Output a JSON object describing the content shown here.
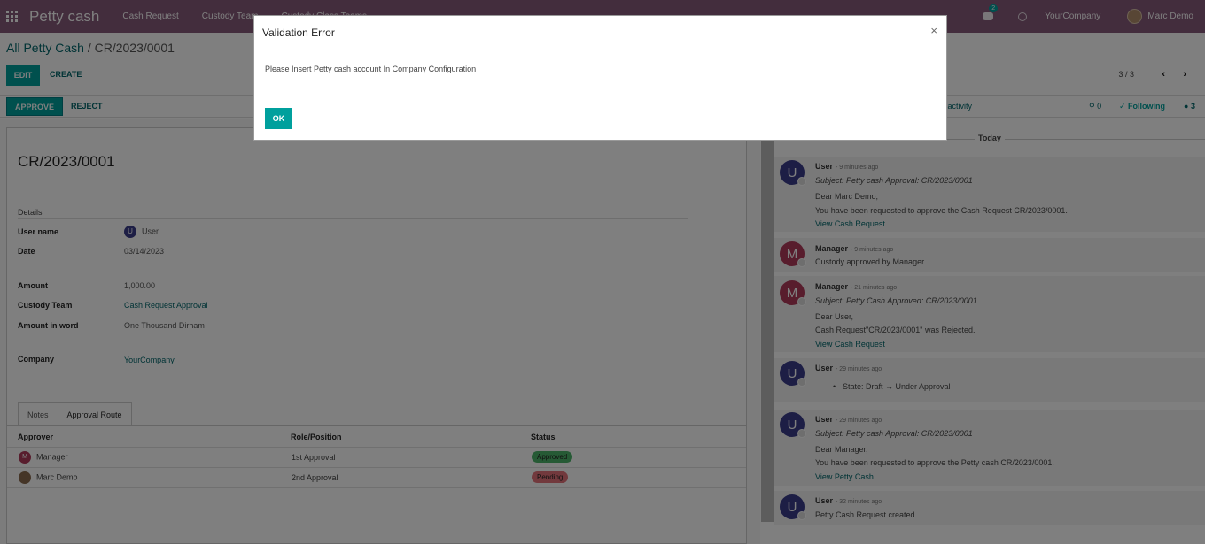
{
  "nav": {
    "brand": "Petty cash",
    "items": [
      "Cash Request",
      "Custody Team",
      "Custody Class Teams"
    ],
    "chat_count": "2",
    "company": "YourCompany",
    "user": "Marc Demo"
  },
  "control": {
    "breadcrumb_root": "All Petty Cash",
    "breadcrumb_sep": " / ",
    "breadcrumb_current": "CR/2023/0001",
    "edit_label": "EDIT",
    "create_label": "CREATE",
    "pager": "3 / 3"
  },
  "status": {
    "approve_label": "APPROVE",
    "reject_label": "REJECT",
    "schedule_label": "ule activity",
    "attachments": "0",
    "following_label": "Following",
    "followers": "3"
  },
  "form": {
    "title": "CR/2023/0001",
    "section": "Details",
    "fields": {
      "user_name_label": "User name",
      "user_name_initial": "U",
      "user_name": "User",
      "date_label": "Date",
      "date": "03/14/2023",
      "amount_label": "Amount",
      "amount": "1,000.00",
      "custody_team_label": "Custody Team",
      "custody_team": "Cash Request Approval",
      "amount_word_label": "Amount in word",
      "amount_word": "One Thousand Dirham",
      "company_label": "Company",
      "company": "YourCompany"
    },
    "tabs": [
      "Notes",
      "Approval Route"
    ],
    "table": {
      "headers": [
        "Approver",
        "Role/Position",
        "Status"
      ],
      "rows": [
        {
          "initial": "M",
          "approver": "Manager",
          "role": "1st Approval",
          "status": "Approved"
        },
        {
          "initial": "",
          "approver": "Marc Demo",
          "role": "2nd Approval",
          "status": "Pending"
        }
      ]
    }
  },
  "chatter": {
    "day": "Today",
    "messages": [
      {
        "initial": "U",
        "author": "User",
        "time": "- 9 minutes ago",
        "subject": "Subject: Petty cash Approval: CR/2023/0001",
        "lines": [
          "Dear Marc Demo,",
          "You have been requested to approve the Cash Request CR/2023/0001."
        ],
        "link": "View Cash Request"
      },
      {
        "initial": "M",
        "author": "Manager",
        "time": "- 9 minutes ago",
        "lines": [
          "Custody approved by Manager"
        ]
      },
      {
        "initial": "M",
        "author": "Manager",
        "time": "- 21 minutes ago",
        "subject": "Subject: Petty Cash Approved: CR/2023/0001",
        "lines": [
          "Dear User,",
          "Cash Request\"CR/2023/0001\" was Rejected."
        ],
        "link": "View Cash Request"
      },
      {
        "initial": "U",
        "author": "User",
        "time": "- 29 minutes ago",
        "tracking": "State: Draft → Under Approval"
      },
      {
        "initial": "U",
        "author": "User",
        "time": "- 29 minutes ago",
        "subject": "Subject: Petty cash Approval: CR/2023/0001",
        "lines": [
          "Dear Manager,",
          "You have been requested to approve the Petty cash CR/2023/0001."
        ],
        "link": "View Petty Cash"
      },
      {
        "initial": "U",
        "author": "User",
        "time": "- 32 minutes ago",
        "lines": [
          "Petty Cash Request created"
        ]
      }
    ]
  },
  "dialog": {
    "title": "Validation Error",
    "close": "×",
    "message": "Please Insert Petty cash account In Company Configuration",
    "ok_label": "OK"
  },
  "colors": {
    "navbar": "#875a7b",
    "primary": "#00a09d",
    "link": "#01666b",
    "user_avatar": "#3b3d8a",
    "manager_avatar": "#b03a5b",
    "approved": "#4cb56a",
    "pending": "#e4737a"
  }
}
